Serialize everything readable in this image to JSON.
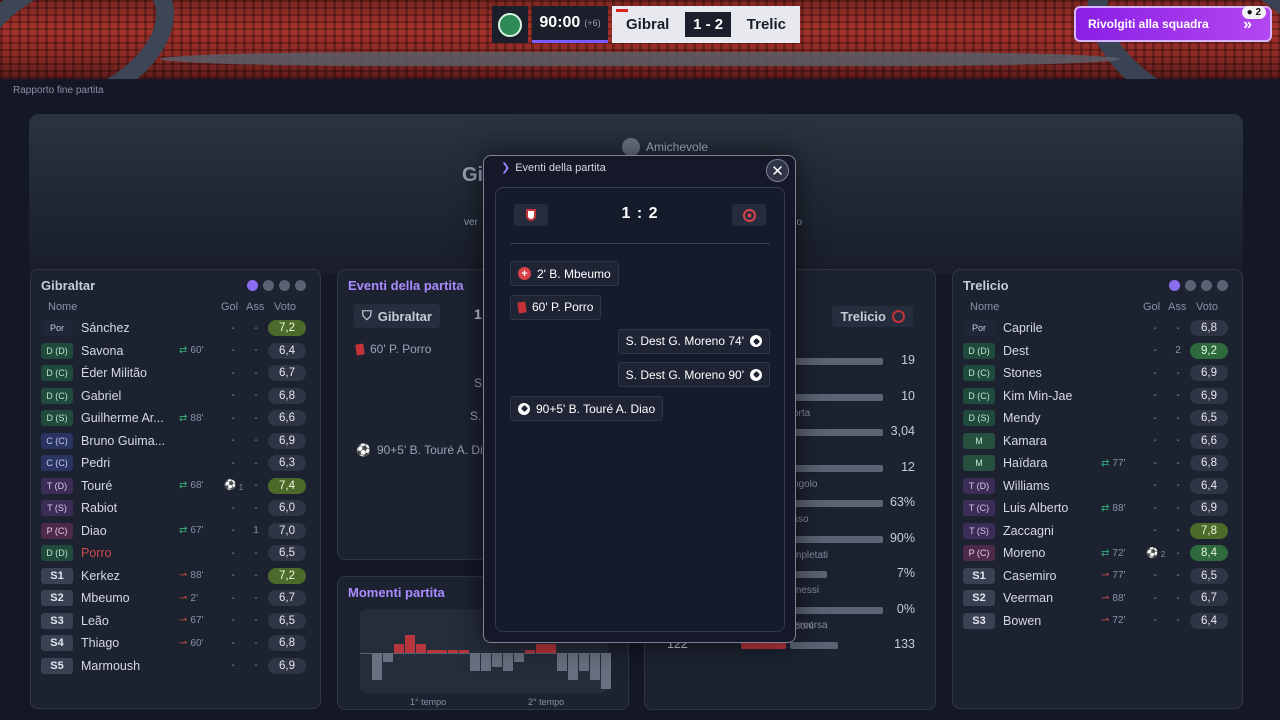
{
  "scoreboard": {
    "clock": "90:00",
    "added_time": "(+6)",
    "home_short": "Gibral",
    "score": "1 - 2",
    "away_short": "Trelic"
  },
  "team_talk": {
    "label": "Rivolgiti alla squadra",
    "badge": "2"
  },
  "page_label": "Rapporto fine partita",
  "hero": {
    "competition": "Amichevole",
    "title_partial": "Gi",
    "sub_left_partial": "ver",
    "sub_right_partial": "no"
  },
  "home_lineup": {
    "team": "Gibraltar",
    "headers": {
      "name": "Nome",
      "goals": "Gol",
      "assists": "Ass",
      "rating": "Voto"
    },
    "players": [
      {
        "pos": "Por",
        "cls": "gk",
        "name": "Sánchez",
        "sub": "",
        "gol": "-",
        "ass": "-",
        "rating": "7,2",
        "rcls": "good"
      },
      {
        "pos": "D (D)",
        "cls": "d",
        "name": "Savona",
        "sub": "60'",
        "subType": "out",
        "gol": "-",
        "ass": "-",
        "rating": "6,4",
        "rcls": ""
      },
      {
        "pos": "D (C)",
        "cls": "d",
        "name": "Éder Militão",
        "sub": "",
        "gol": "-",
        "ass": "-",
        "rating": "6,7",
        "rcls": ""
      },
      {
        "pos": "D (C)",
        "cls": "d",
        "name": "Gabriel",
        "sub": "",
        "gol": "-",
        "ass": "-",
        "rating": "6,8",
        "rcls": ""
      },
      {
        "pos": "D (S)",
        "cls": "d",
        "name": "Guilherme Ar...",
        "sub": "88'",
        "subType": "out",
        "gol": "-",
        "ass": "-",
        "rating": "6,6",
        "rcls": ""
      },
      {
        "pos": "C (C)",
        "cls": "c",
        "name": "Bruno Guima...",
        "sub": "",
        "gol": "-",
        "ass": "-",
        "rating": "6,9",
        "rcls": ""
      },
      {
        "pos": "C (C)",
        "cls": "c",
        "name": "Pedri",
        "sub": "",
        "gol": "-",
        "ass": "-",
        "rating": "6,3",
        "rcls": ""
      },
      {
        "pos": "T (D)",
        "cls": "t",
        "name": "Touré",
        "sub": "68'",
        "subType": "out",
        "gol": "1",
        "ass": "-",
        "rating": "7,4",
        "rcls": "good",
        "scored": true
      },
      {
        "pos": "T (S)",
        "cls": "t",
        "name": "Rabiot",
        "sub": "",
        "gol": "-",
        "ass": "-",
        "rating": "6,0",
        "rcls": ""
      },
      {
        "pos": "P (C)",
        "cls": "p",
        "name": "Diao",
        "sub": "67'",
        "subType": "out",
        "gol": "-",
        "ass": "1",
        "rating": "7,0",
        "rcls": ""
      },
      {
        "pos": "D (D)",
        "cls": "d",
        "name": "Porro",
        "sub": "",
        "gol": "-",
        "ass": "-",
        "rating": "6,5",
        "rcls": "",
        "red": true
      },
      {
        "pos": "S1",
        "cls": "s",
        "name": "Kerkez",
        "sub": "88'",
        "subType": "in",
        "gol": "-",
        "ass": "-",
        "rating": "7,2",
        "rcls": "good"
      },
      {
        "pos": "S2",
        "cls": "s",
        "name": "Mbeumo",
        "sub": "2'",
        "subType": "in",
        "gol": "-",
        "ass": "-",
        "rating": "6,7",
        "rcls": ""
      },
      {
        "pos": "S3",
        "cls": "s",
        "name": "Leão",
        "sub": "67'",
        "subType": "in",
        "gol": "-",
        "ass": "-",
        "rating": "6,5",
        "rcls": ""
      },
      {
        "pos": "S4",
        "cls": "s",
        "name": "Thiago",
        "sub": "60'",
        "subType": "in",
        "gol": "-",
        "ass": "-",
        "rating": "6,8",
        "rcls": ""
      },
      {
        "pos": "S5",
        "cls": "s",
        "name": "Marmoush",
        "sub": "",
        "gol": "-",
        "ass": "-",
        "rating": "6,9",
        "rcls": ""
      }
    ]
  },
  "away_lineup": {
    "team": "Trelicio",
    "headers": {
      "name": "Nome",
      "goals": "Gol",
      "assists": "Ass",
      "rating": "Voto"
    },
    "players": [
      {
        "pos": "Por",
        "cls": "gk",
        "name": "Caprile",
        "sub": "",
        "gol": "-",
        "ass": "-",
        "rating": "6,8",
        "rcls": ""
      },
      {
        "pos": "D (D)",
        "cls": "d",
        "name": "Dest",
        "sub": "",
        "gol": "-",
        "ass": "2",
        "rating": "9,2",
        "rcls": "great"
      },
      {
        "pos": "D (C)",
        "cls": "d",
        "name": "Stones",
        "sub": "",
        "gol": "-",
        "ass": "-",
        "rating": "6,9",
        "rcls": ""
      },
      {
        "pos": "D (C)",
        "cls": "d",
        "name": "Kim Min-Jae",
        "sub": "",
        "gol": "-",
        "ass": "-",
        "rating": "6,9",
        "rcls": ""
      },
      {
        "pos": "D (S)",
        "cls": "d",
        "name": "Mendy",
        "sub": "",
        "gol": "-",
        "ass": "-",
        "rating": "6,5",
        "rcls": ""
      },
      {
        "pos": "M",
        "cls": "m",
        "name": "Kamara",
        "sub": "",
        "gol": "-",
        "ass": "-",
        "rating": "6,6",
        "rcls": ""
      },
      {
        "pos": "M",
        "cls": "m",
        "name": "Haïdara",
        "sub": "77'",
        "subType": "out",
        "gol": "-",
        "ass": "-",
        "rating": "6,8",
        "rcls": ""
      },
      {
        "pos": "T (D)",
        "cls": "t",
        "name": "Williams",
        "sub": "",
        "gol": "-",
        "ass": "-",
        "rating": "6,4",
        "rcls": ""
      },
      {
        "pos": "T (C)",
        "cls": "t",
        "name": "Luis Alberto",
        "sub": "88'",
        "subType": "out",
        "gol": "-",
        "ass": "-",
        "rating": "6,9",
        "rcls": ""
      },
      {
        "pos": "T (S)",
        "cls": "t",
        "name": "Zaccagni",
        "sub": "",
        "gol": "-",
        "ass": "-",
        "rating": "7,8",
        "rcls": "good"
      },
      {
        "pos": "P (C)",
        "cls": "p",
        "name": "Moreno",
        "sub": "72'",
        "subType": "out",
        "gol": "2",
        "ass": "-",
        "rating": "8,4",
        "rcls": "great",
        "scored": true
      },
      {
        "pos": "S1",
        "cls": "s",
        "name": "Casemiro",
        "sub": "77'",
        "subType": "in",
        "gol": "-",
        "ass": "-",
        "rating": "6,5",
        "rcls": ""
      },
      {
        "pos": "S2",
        "cls": "s",
        "name": "Veerman",
        "sub": "88'",
        "subType": "in",
        "gol": "-",
        "ass": "-",
        "rating": "6,7",
        "rcls": ""
      },
      {
        "pos": "S3",
        "cls": "s",
        "name": "Bowen",
        "sub": "72'",
        "subType": "in",
        "gol": "-",
        "ass": "-",
        "rating": "6,4",
        "rcls": ""
      }
    ]
  },
  "events_panel_bg": {
    "title": "Eventi della partita",
    "home_team": "Gibraltar",
    "score_partial": "1",
    "item_card": "60' P. Porro",
    "item_s1": "S.",
    "item_s2": "S.",
    "item_goal": "90+5' B. Touré A. Di"
  },
  "moments": {
    "title": "Momenti partita",
    "first_half": "1° tempo",
    "second_half": "2° tempo",
    "values": [
      -3,
      -1,
      1,
      2,
      1,
      0.3,
      0.3,
      0.3,
      0.3,
      -2,
      -2,
      -1.5,
      -2,
      -1,
      0.3,
      1,
      1,
      -2,
      -3,
      -2,
      -3,
      -4
    ]
  },
  "stats": {
    "away_team": "Trelicio",
    "rows": [
      {
        "label": "",
        "home": "",
        "away": "19",
        "home_frac": 0,
        "away_frac": 1
      },
      {
        "label": "orta",
        "home": "",
        "away": "10",
        "home_frac": 0,
        "away_frac": 1
      },
      {
        "label": "",
        "home": "",
        "away": "3,04",
        "home_frac": 0,
        "away_frac": 1
      },
      {
        "label": "ngolo",
        "home": "",
        "away": "12",
        "home_frac": 0,
        "away_frac": 1
      },
      {
        "label": "sso",
        "home": "",
        "away": "63%",
        "home_frac": 0,
        "away_frac": 1
      },
      {
        "label": "mpletati",
        "home": "",
        "away": "90%",
        "home_frac": 0,
        "away_frac": 1
      },
      {
        "label": "messi",
        "home": "",
        "away": "7%",
        "home_frac": 0.4,
        "away_frac": 0.4
      },
      {
        "label": "zioni",
        "home": "",
        "away": "0%",
        "home_frac": 0,
        "away_frac": 1
      },
      {
        "label": "Distanza percorsa",
        "home": "122",
        "away": "133",
        "home_frac": 0.48,
        "away_frac": 0.52
      }
    ]
  },
  "modal": {
    "title": "Eventi della partita",
    "score": "1 : 2",
    "events": [
      {
        "side": "home",
        "kind": "sub",
        "text": "2' B. Mbeumo"
      },
      {
        "side": "home",
        "kind": "card",
        "text": "60' P. Porro"
      },
      {
        "side": "away",
        "kind": "goal",
        "text": "S. Dest  G. Moreno 74'"
      },
      {
        "side": "away",
        "kind": "goal",
        "text": "S. Dest  G. Moreno 90'"
      },
      {
        "side": "home",
        "kind": "goal",
        "text": "90+5' B. Touré  A. Diao"
      }
    ]
  }
}
